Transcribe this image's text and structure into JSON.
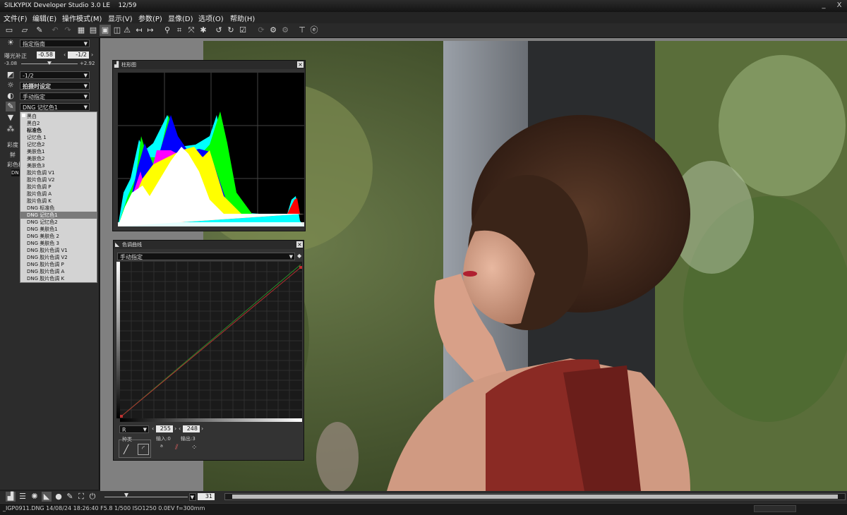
{
  "window": {
    "title": "SILKYPIX Developer Studio 3.0 LE    12/59",
    "minimize": "_",
    "close": "X"
  },
  "menu": [
    "文件(F)",
    "编辑(E)",
    "操作模式(M)",
    "显示(V)",
    "参数(P)",
    "显像(D)",
    "选项(O)",
    "帮助(H)"
  ],
  "left": {
    "preset_combo": "指定指南",
    "exposure_label": "曝光补正",
    "exposure_value": "-0.58",
    "exposure_step": "-1/2",
    "exposure_min": "-3.08",
    "exposure_max": "+2.92",
    "exposure_fraction": 0.5,
    "contrast_combo": "-1/2",
    "wb_combo": "拍摄时设定",
    "tone_combo": "手动指定",
    "color_combo": "DNG 记忆色1",
    "side_labels": [
      "彩度",
      "鲜",
      "彩色模"
    ],
    "side_badge": "DN"
  },
  "dropdown_items": [
    {
      "label": "黑白",
      "selected": false,
      "bold": false
    },
    {
      "label": "黑白2",
      "selected": false,
      "bold": false
    },
    {
      "label": "标准色",
      "selected": false,
      "bold": true
    },
    {
      "label": "记忆色 1",
      "selected": false,
      "bold": false
    },
    {
      "label": "记忆色2",
      "selected": false,
      "bold": false
    },
    {
      "label": "美肤色1",
      "selected": false,
      "bold": false
    },
    {
      "label": "美肤色2",
      "selected": false,
      "bold": false
    },
    {
      "label": "美肤色3",
      "selected": false,
      "bold": false
    },
    {
      "label": "胶片色调 V1",
      "selected": false,
      "bold": false
    },
    {
      "label": "胶片色调 V2",
      "selected": false,
      "bold": false
    },
    {
      "label": "胶片色调 P",
      "selected": false,
      "bold": false
    },
    {
      "label": "胶片色调 A",
      "selected": false,
      "bold": false
    },
    {
      "label": "胶片色调 K",
      "selected": false,
      "bold": false
    },
    {
      "label": "DNG 标准色",
      "selected": false,
      "bold": false
    },
    {
      "label": "DNG 记忆色1",
      "selected": true,
      "bold": false
    },
    {
      "label": "DNG 记忆色2",
      "selected": false,
      "bold": false
    },
    {
      "label": "DNG 美肤色1",
      "selected": false,
      "bold": false
    },
    {
      "label": "DNG 美肤色 2",
      "selected": false,
      "bold": false
    },
    {
      "label": "DNG 美肤色 3",
      "selected": false,
      "bold": false
    },
    {
      "label": "DNG 胶片色调 V1",
      "selected": false,
      "bold": false
    },
    {
      "label": "DNG 胶片色调 V2",
      "selected": false,
      "bold": false
    },
    {
      "label": "DNG 胶片色调 P",
      "selected": false,
      "bold": false
    },
    {
      "label": "DNG 胶片色调 A",
      "selected": false,
      "bold": false
    },
    {
      "label": "DNG 胶片色调 K",
      "selected": false,
      "bold": false
    }
  ],
  "histogram": {
    "title": "柱形图",
    "close": "×"
  },
  "tonecurve": {
    "title": "色调曲线",
    "mode_combo": "手动指定",
    "channel_combo": "R",
    "input_max": "255",
    "output_max": "248",
    "group_label": "种类",
    "input_label": "输入:0",
    "output_label": "输出:3"
  },
  "bottom": {
    "zoom_value": "31"
  },
  "status": {
    "text": "_IGP0911.DNG 14/08/24 18:26:40 F5.8 1/500 ISO1250 0.0EV f=300mm"
  },
  "colors": {
    "accent": "#7a7a7a",
    "panel_bg": "#333333"
  }
}
